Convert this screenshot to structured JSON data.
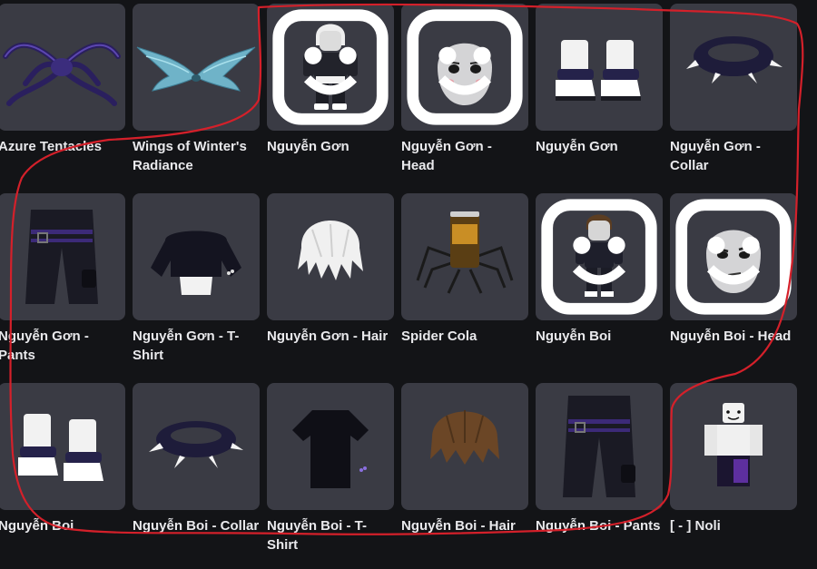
{
  "items": [
    {
      "name": "Azure Tentacles"
    },
    {
      "name": "Wings of Winter's Radiance"
    },
    {
      "name": "Nguyễn Gơn"
    },
    {
      "name": "Nguyễn Gơn - Head"
    },
    {
      "name": "Nguyễn Gơn"
    },
    {
      "name": "Nguyễn Gơn - Collar"
    },
    {
      "name": "Nguyễn Gơn - Pants"
    },
    {
      "name": "Nguyễn Gơn - T-Shirt"
    },
    {
      "name": "Nguyễn Gơn - Hair"
    },
    {
      "name": "Spider Cola"
    },
    {
      "name": "Nguyễn Boi"
    },
    {
      "name": "Nguyễn Boi - Head"
    },
    {
      "name": "Nguyễn Boi"
    },
    {
      "name": "Nguyễn Boi - Collar"
    },
    {
      "name": "Nguyễn Boi - T-Shirt"
    },
    {
      "name": "Nguyễn Boi - Hair"
    },
    {
      "name": "Nguyễn Boi - Pants"
    },
    {
      "name": "[ - ] Noli"
    }
  ],
  "colors": {
    "background": "#131417",
    "tile": "#3a3b44",
    "text": "#e9e9ec",
    "annotation": "#d4202a"
  }
}
